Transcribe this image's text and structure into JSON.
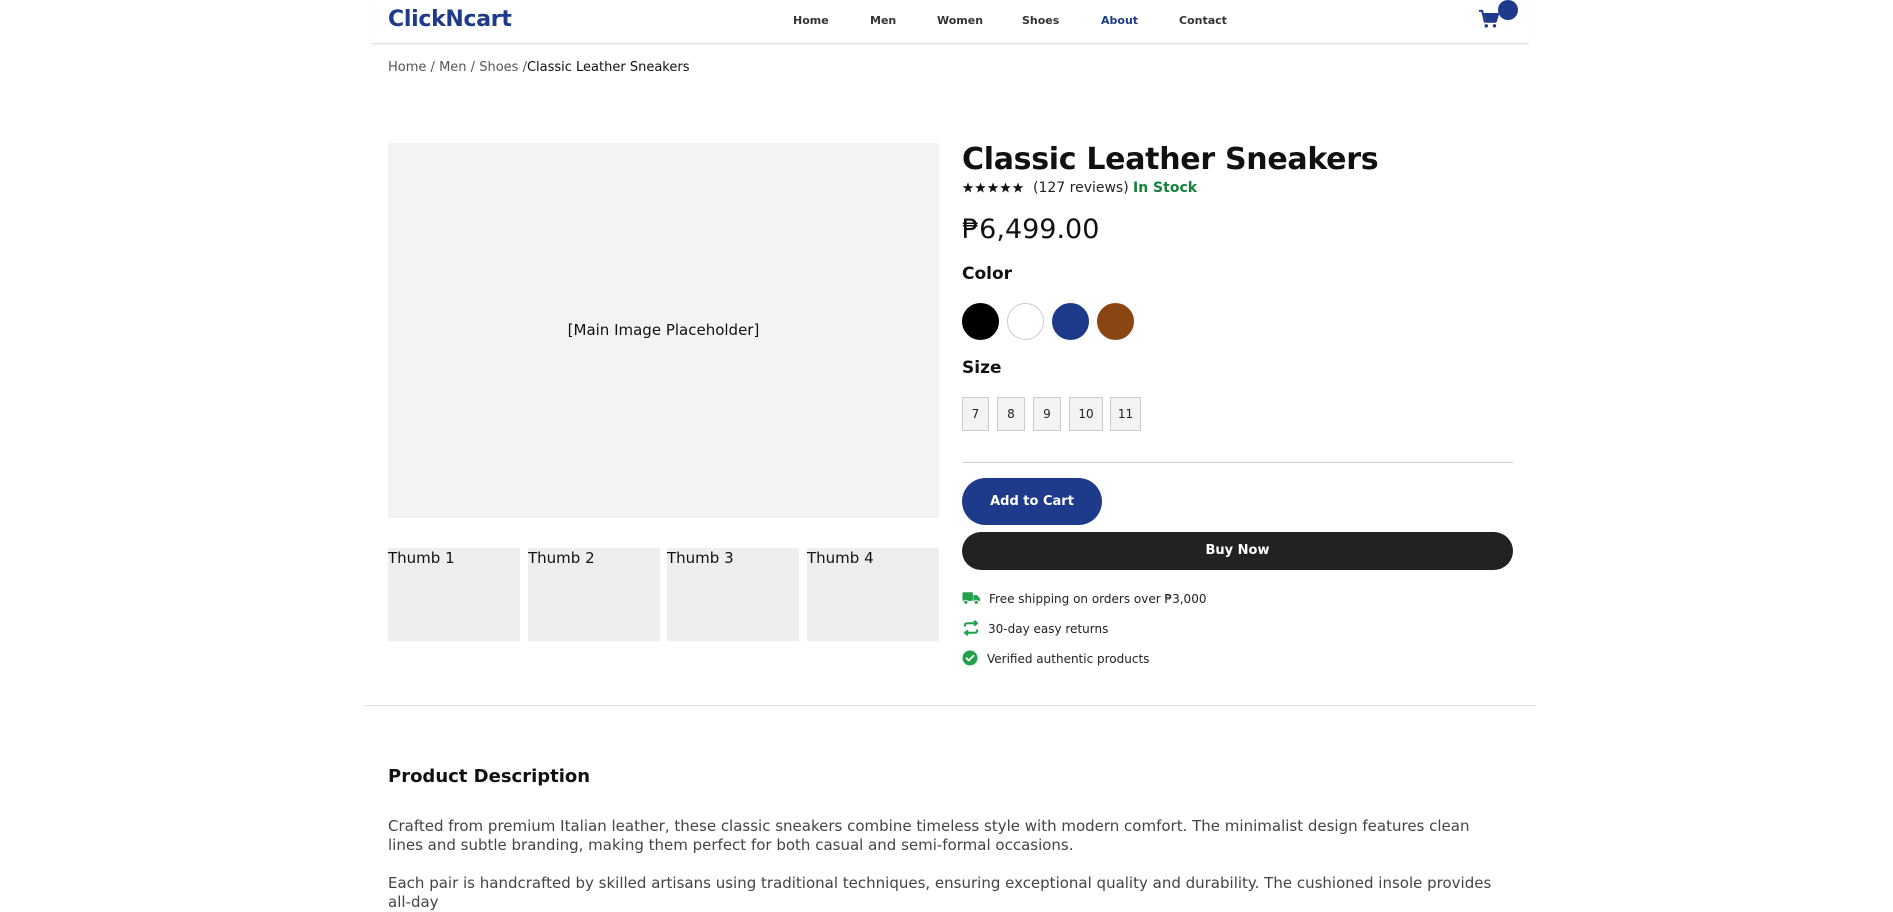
{
  "nav": {
    "brand": "ClickNcart",
    "links": [
      "Home",
      "Men",
      "Women",
      "Shoes",
      "About",
      "Contact"
    ],
    "active_link": "About"
  },
  "breadcrumb": {
    "items": [
      "Home",
      "Men",
      "Shoes"
    ],
    "separator": "/",
    "current": "Classic Leather Sneakers"
  },
  "gallery": {
    "main_image_label": "[Main Image Placeholder]",
    "thumbnails": [
      "Thumb 1",
      "Thumb 2",
      "Thumb 3",
      "Thumb 4"
    ]
  },
  "product": {
    "title": "Classic Leather Sneakers",
    "rating": 5,
    "rating_max": 5,
    "reviews": "(127 reviews)",
    "stock_status": "In Stock",
    "price": "₱6,499.00",
    "color_label": "Color",
    "colors": [
      {
        "name": "black",
        "hex": "#000000"
      },
      {
        "name": "white",
        "hex": "#ffffff"
      },
      {
        "name": "navy",
        "hex": "#1e3a8a"
      },
      {
        "name": "brown",
        "hex": "#8b4513"
      }
    ],
    "size_label": "Size",
    "sizes": [
      "7",
      "8",
      "9",
      "10",
      "11"
    ],
    "add_to_cart": "Add to Cart",
    "buy_now": "Buy Now"
  },
  "perks": [
    {
      "icon": "truck-icon",
      "text": "Free shipping on orders over ₱3,000"
    },
    {
      "icon": "returns-icon",
      "text": "30-day easy returns"
    },
    {
      "icon": "check-circle-icon",
      "text": "Verified authentic products"
    }
  ],
  "description": {
    "heading": "Product Description",
    "paragraphs": [
      "Crafted from premium Italian leather, these classic sneakers combine timeless style with modern comfort. The minimalist design features clean lines and subtle branding, making them perfect for both casual and semi-formal occasions.",
      "Each pair is handcrafted by skilled artisans using traditional techniques, ensuring exceptional quality and durability. The cushioned insole provides all-day"
    ]
  },
  "colors": {
    "brand": "#1e3a8a",
    "stock": "#15803d",
    "perk_icon": "#22a04b",
    "dark_button": "#222222"
  }
}
